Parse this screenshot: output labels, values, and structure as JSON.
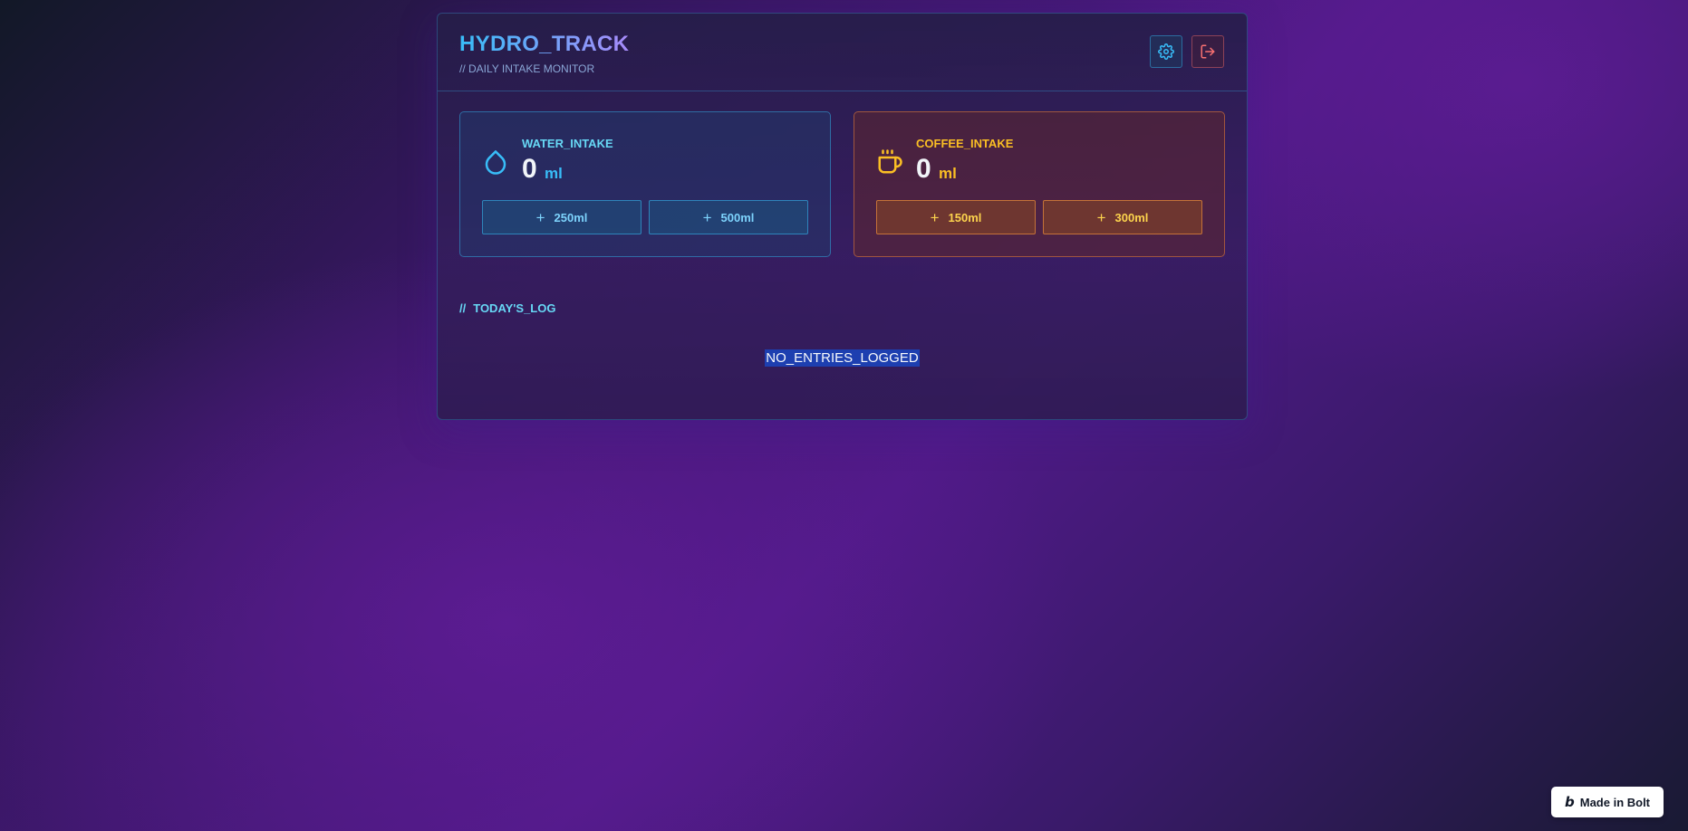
{
  "app": {
    "title": "HYDRO_TRACK",
    "subtitle": "// DAILY INTAKE MONITOR"
  },
  "header_actions": {
    "settings_icon": "gear-icon",
    "logout_icon": "logout-icon"
  },
  "water": {
    "label": "WATER_INTAKE",
    "value": "0",
    "unit": "ml",
    "icon": "droplet-icon",
    "buttons": [
      {
        "plus": "+",
        "label": "250ml"
      },
      {
        "plus": "+",
        "label": "500ml"
      }
    ]
  },
  "coffee": {
    "label": "COFFEE_INTAKE",
    "value": "0",
    "unit": "ml",
    "icon": "coffee-cup-icon",
    "buttons": [
      {
        "plus": "+",
        "label": "150ml"
      },
      {
        "plus": "+",
        "label": "300ml"
      }
    ]
  },
  "log": {
    "prefix": "//",
    "title": "TODAY'S_LOG",
    "empty_message": "NO_ENTRIES_LOGGED"
  },
  "badge": {
    "logo": "b",
    "label": "Made in Bolt"
  },
  "colors": {
    "water_accent": "#38bdf8",
    "coffee_accent": "#fbbf24",
    "logout_accent": "#f87171"
  }
}
